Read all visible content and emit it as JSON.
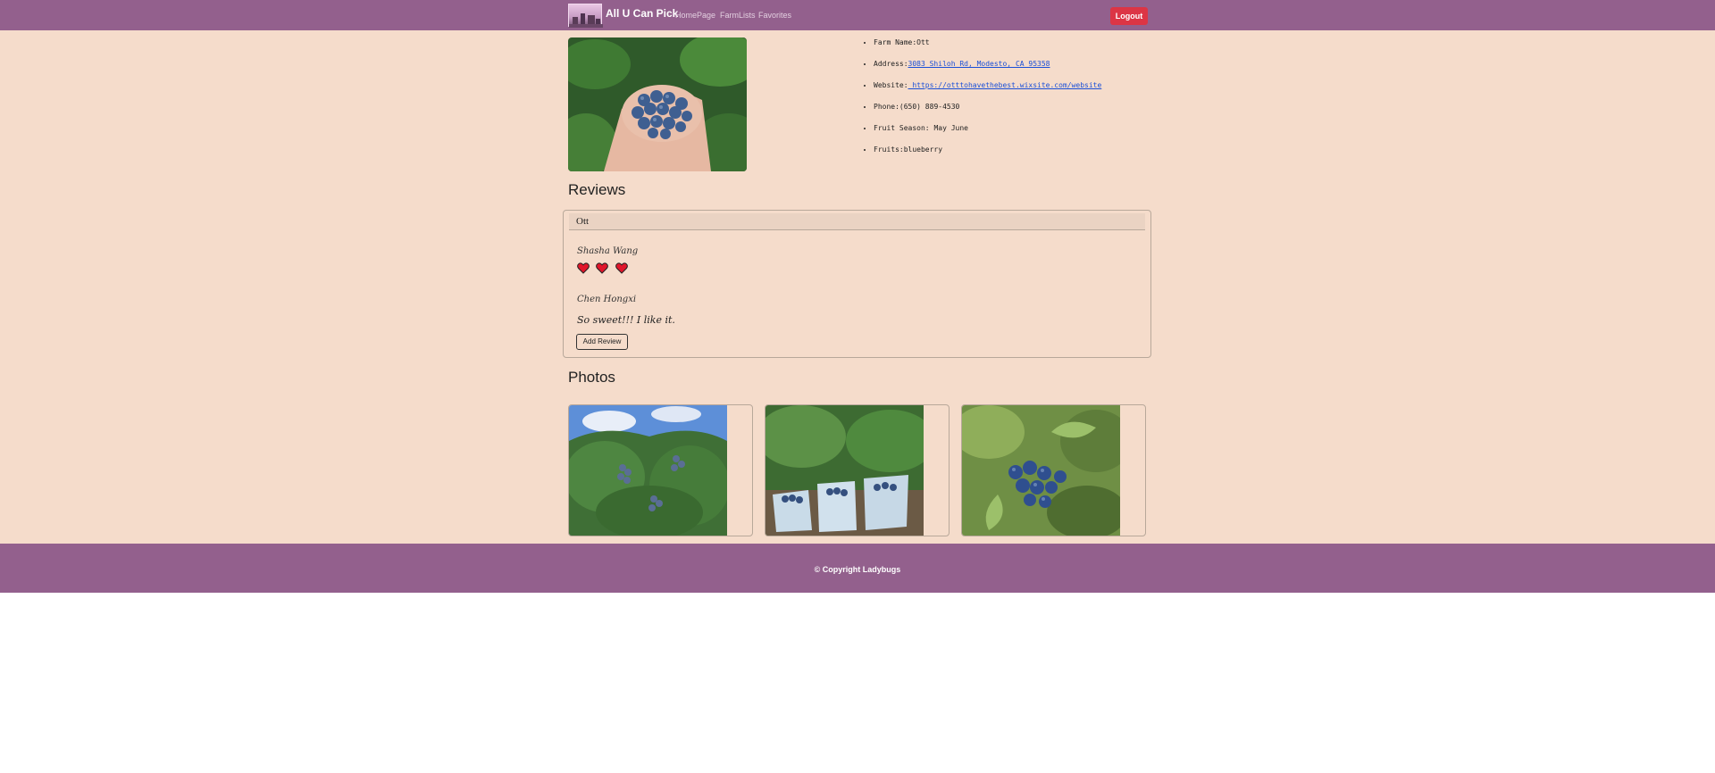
{
  "nav": {
    "brand": "All U Can Pick",
    "links": [
      "HomePage",
      "FarmLists",
      "Favorites"
    ],
    "logout": "Logout"
  },
  "farm": {
    "items": [
      {
        "label": "Farm Name:",
        "value": "Ott"
      },
      {
        "label": "Address:",
        "value": "3083 Shiloh Rd, Modesto, CA 95358"
      },
      {
        "label": "Website:",
        "value": " https://otttohavethebest.wixsite.com/website"
      },
      {
        "label": "Phone:",
        "value": "(650) 889-4530"
      },
      {
        "label": "Fruit Season:",
        "value": " May June"
      },
      {
        "label": "Fruits:",
        "value": "blueberry"
      }
    ]
  },
  "reviews": {
    "title": "Reviews",
    "header": "Ott",
    "entries": [
      {
        "name": "Shasha Wang",
        "hearts": 3
      },
      {
        "name": "Chen Hongxi",
        "text": "So sweet!!! I like it."
      }
    ],
    "add_label": "Add Review"
  },
  "photos": {
    "title": "Photos"
  },
  "footer": {
    "copyright": "© Copyright Ladybugs"
  },
  "colors": {
    "nav": "#93608d",
    "page_bg": "#f5dccb",
    "logout": "#dc3545",
    "link": "#1a4fd8"
  }
}
